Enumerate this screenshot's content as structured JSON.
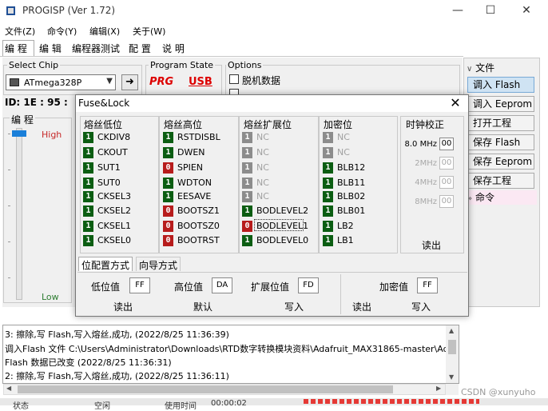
{
  "window": {
    "title": "PROGISP (Ver 1.72)"
  },
  "menu": [
    "文件(Z)",
    "命令(Y)",
    "编辑(X)",
    "关于(W)"
  ],
  "main_tabs": [
    "编 程",
    "编 辑",
    "编程器测试",
    "配 置",
    "说 明"
  ],
  "chip": {
    "group_label": "Select Chip",
    "selected": "ATmega328P",
    "id_text": "ID: 1E : 95 :"
  },
  "program_state": {
    "label": "Program State",
    "prg": "PRG",
    "usb": "USB"
  },
  "options": {
    "label": "Options",
    "offline": "脱机数据"
  },
  "programming": {
    "label": "编 程",
    "high": "High",
    "low": "Low"
  },
  "files": {
    "header": "文件",
    "buttons": [
      "调入 Flash",
      "调入 Eeprom",
      "打开工程",
      "保存 Flash",
      "保存 Eeprom",
      "保存工程"
    ],
    "command_header": "命令"
  },
  "log": [
    "3: 擦除,写 Flash,写入熔丝,成功, (2022/8/25 11:36:39)",
    "调入Flash 文件 C:\\Users\\Administrator\\Downloads\\RTD数字转换模块资料\\Adafruit_MAX31865-master\\Adafruit_",
    "Flash 数据已改变 (2022/8/25 11:36:31)",
    "2: 擦除,写 Flash,写入熔丝,成功, (2022/8/25 11:36:11)"
  ],
  "status_bar": [
    "状态",
    "空闲",
    "使用时间",
    "00:00:02"
  ],
  "watermark": "CSDN @xunyuho",
  "dialog": {
    "title": "Fuse&Lock",
    "columns": [
      {
        "header": "熔丝低位",
        "items": [
          {
            "bit": "1",
            "name": "CKDIV8",
            "state": "on"
          },
          {
            "bit": "1",
            "name": "CKOUT",
            "state": "on"
          },
          {
            "bit": "1",
            "name": "SUT1",
            "state": "on"
          },
          {
            "bit": "1",
            "name": "SUT0",
            "state": "on"
          },
          {
            "bit": "1",
            "name": "CKSEL3",
            "state": "on"
          },
          {
            "bit": "1",
            "name": "CKSEL2",
            "state": "on"
          },
          {
            "bit": "1",
            "name": "CKSEL1",
            "state": "on"
          },
          {
            "bit": "1",
            "name": "CKSEL0",
            "state": "on"
          }
        ]
      },
      {
        "header": "熔丝高位",
        "items": [
          {
            "bit": "1",
            "name": "RSTDISBL",
            "state": "on"
          },
          {
            "bit": "1",
            "name": "DWEN",
            "state": "on"
          },
          {
            "bit": "0",
            "name": "SPIEN",
            "state": "zero"
          },
          {
            "bit": "1",
            "name": "WDTON",
            "state": "on"
          },
          {
            "bit": "1",
            "name": "EESAVE",
            "state": "on"
          },
          {
            "bit": "0",
            "name": "BOOTSZ1",
            "state": "zero"
          },
          {
            "bit": "0",
            "name": "BOOTSZ0",
            "state": "zero"
          },
          {
            "bit": "0",
            "name": "BOOTRST",
            "state": "zero"
          }
        ]
      },
      {
        "header": "熔丝扩展位",
        "items": [
          {
            "bit": "1",
            "name": "NC",
            "state": "disabled"
          },
          {
            "bit": "1",
            "name": "NC",
            "state": "disabled"
          },
          {
            "bit": "1",
            "name": "NC",
            "state": "disabled"
          },
          {
            "bit": "1",
            "name": "NC",
            "state": "disabled"
          },
          {
            "bit": "1",
            "name": "NC",
            "state": "disabled"
          },
          {
            "bit": "1",
            "name": "BODLEVEL2",
            "state": "on"
          },
          {
            "bit": "0",
            "name": "BODLEVEL1",
            "state": "zero"
          },
          {
            "bit": "1",
            "name": "BODLEVEL0",
            "state": "on"
          }
        ]
      },
      {
        "header": "加密位",
        "items": [
          {
            "bit": "1",
            "name": "NC",
            "state": "disabled"
          },
          {
            "bit": "1",
            "name": "NC",
            "state": "disabled"
          },
          {
            "bit": "1",
            "name": "BLB12",
            "state": "on"
          },
          {
            "bit": "1",
            "name": "BLB11",
            "state": "on"
          },
          {
            "bit": "1",
            "name": "BLB02",
            "state": "on"
          },
          {
            "bit": "1",
            "name": "BLB01",
            "state": "on"
          },
          {
            "bit": "1",
            "name": "LB2",
            "state": "on"
          },
          {
            "bit": "1",
            "name": "LB1",
            "state": "on"
          }
        ]
      }
    ],
    "clock": {
      "header": "时钟校正",
      "rows": [
        {
          "label": "8.0 MHz",
          "value": "00",
          "enabled": true
        },
        {
          "label": "2MHz",
          "value": "00",
          "enabled": false
        },
        {
          "label": "4MHz",
          "value": "00",
          "enabled": false
        },
        {
          "label": "8MHz",
          "value": "00",
          "enabled": false
        }
      ],
      "read": "读出"
    },
    "subtabs": [
      "位配置方式",
      "向导方式"
    ],
    "values": {
      "low_label": "低位值",
      "low": "FF",
      "high_label": "高位值",
      "high": "DA",
      "ext_label": "扩展位值",
      "ext": "FD",
      "lock_label": "加密值",
      "lock": "FF"
    },
    "actions": {
      "read": "读出",
      "default": "默认",
      "write": "写入",
      "lock_read": "读出",
      "lock_write": "写入"
    }
  },
  "colors": {
    "bit_on": "#0b5d12",
    "bit_zero": "#b71c1c",
    "bit_disabled": "#8c8c8c"
  }
}
